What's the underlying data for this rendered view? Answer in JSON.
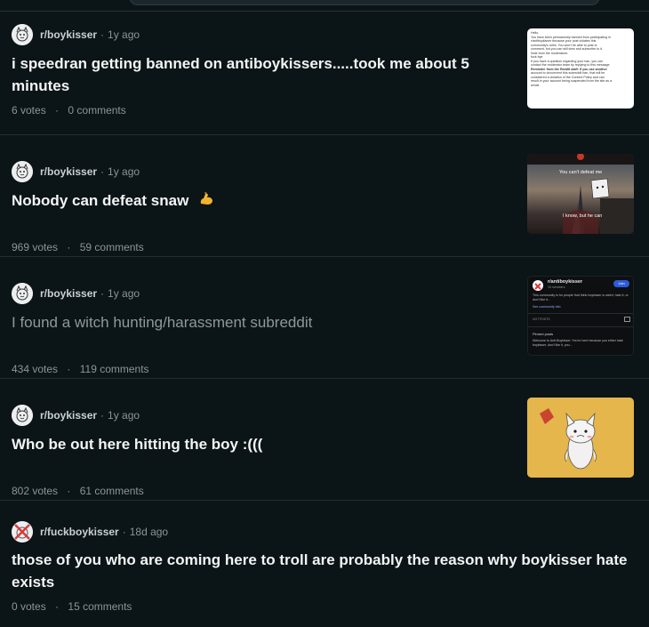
{
  "posts": [
    {
      "subreddit": "r/boykisser",
      "time": "1y ago",
      "title": "i speedran getting banned on antiboykissers.....took me about 5 minutes",
      "votes": "6 votes",
      "comments": "0 comments",
      "thumb": {
        "type": "ban-message",
        "lines": [
          "Hello,",
          "You have been permanently banned from participating in",
          "r/antiboykisser because your post violates this",
          "community's rules. You won't be able to post or",
          "comment, but you can still view and subscribe to it.",
          "Note from the moderators:",
          "fuck bye",
          "If you have a question regarding your ban, you can",
          "contact the moderator team by replying to this message.",
          "Reminder from the Reddit staff: If you use another",
          "account to circumvent this subreddit ban, that will be",
          "considered a violation of the Content Policy and can",
          "result in your account being suspended from the site as a",
          "whole."
        ]
      }
    },
    {
      "subreddit": "r/boykisser",
      "time": "1y ago",
      "title": "Nobody can defeat snaw",
      "votes": "969 votes",
      "comments": "59 comments",
      "thumb": {
        "type": "meme",
        "top": "You can't defeat me",
        "bottom": "I know, but he can"
      }
    },
    {
      "subreddit": "r/boykisser",
      "time": "1y ago",
      "title": "I found a witch hunting/harassment subreddit",
      "votes": "434 votes",
      "comments": "119 comments",
      "thumb": {
        "type": "subreddit-card",
        "name": "r/antiboykisser",
        "join": "Join",
        "members": "15 members",
        "desc": "This community is for people that think boykisser is weird, hate it, or don't like it...",
        "see_more": "See community info",
        "hot": "HOT POSTS",
        "pinned": "Pinned posts",
        "pinned_text": "Welcome to Anti-Boykisser. You're here because you either hate boykisser, don't like it, you..."
      }
    },
    {
      "subreddit": "r/boykisser",
      "time": "1y ago",
      "title": "Who be out here hitting the boy :(((",
      "votes": "802 votes",
      "comments": "61 comments",
      "thumb": {
        "type": "drawing"
      }
    },
    {
      "subreddit": "r/fuckboykisser",
      "time": "18d ago",
      "title": "those of you who are coming here to troll are probably the reason why boykisser hate exists",
      "votes": "0 votes",
      "comments": "15 comments",
      "thumb": null
    }
  ],
  "colors": {
    "background": "#0b1416",
    "title": "#f2f4f5",
    "visited_title": "#8c999e",
    "meta": "#8a969b"
  }
}
